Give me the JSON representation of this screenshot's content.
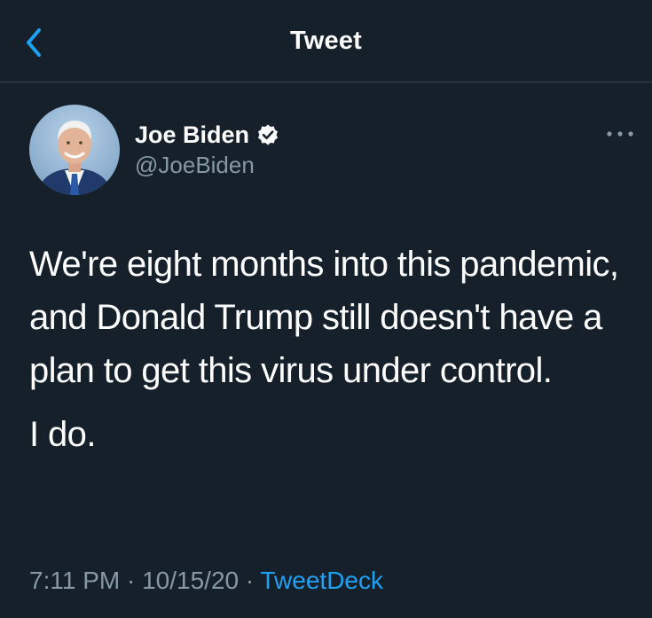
{
  "header": {
    "title": "Tweet",
    "back_icon": "chevron-left-icon"
  },
  "tweet": {
    "author": {
      "name": "Joe Biden",
      "handle": "@JoeBiden",
      "verified": true,
      "verified_icon": "verified-badge-icon"
    },
    "more_icon": "more-horizontal-icon",
    "paragraphs": [
      "We're eight months into this pandemic, and Donald Trump still doesn't have a plan to get this virus under control.",
      "I do."
    ],
    "time": "7:11 PM",
    "date": "10/15/20",
    "separator": "·",
    "source": "TweetDeck"
  },
  "colors": {
    "background": "#15202b",
    "text": "#ffffff",
    "secondary_text": "#8899a6",
    "accent": "#1da1f2",
    "divider": "#38444d"
  }
}
